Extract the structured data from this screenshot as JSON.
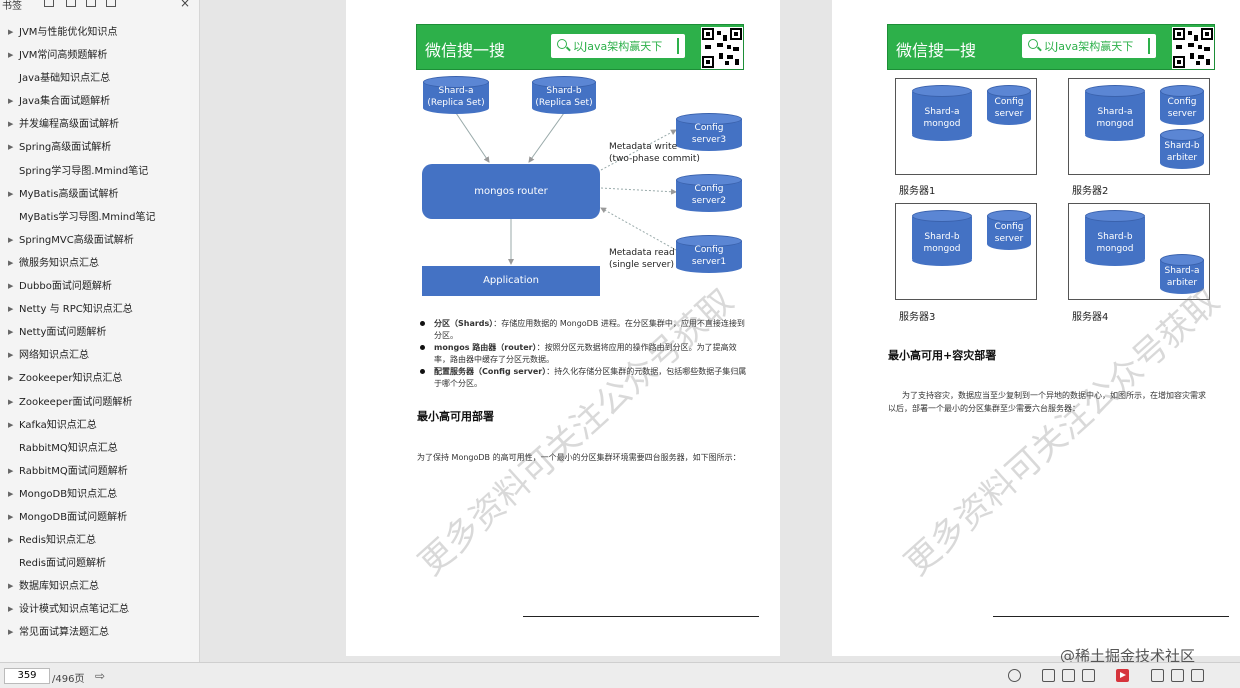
{
  "sidebar": {
    "title": "书签",
    "items": [
      {
        "label": "JVM与性能优化知识点",
        "arrow": true
      },
      {
        "label": "JVM常问高频题解析",
        "arrow": true
      },
      {
        "label": "Java基础知识点汇总",
        "arrow": false
      },
      {
        "label": "Java集合面试题解析",
        "arrow": true
      },
      {
        "label": "并发编程高级面试解析",
        "arrow": true
      },
      {
        "label": "Spring高级面试解析",
        "arrow": true
      },
      {
        "label": "Spring学习导图.Mmind笔记",
        "arrow": false
      },
      {
        "label": "MyBatis高级面试解析",
        "arrow": true
      },
      {
        "label": "MyBatis学习导图.Mmind笔记",
        "arrow": false
      },
      {
        "label": "SpringMVC高级面试解析",
        "arrow": true
      },
      {
        "label": "微服务知识点汇总",
        "arrow": true
      },
      {
        "label": "Dubbo面试问题解析",
        "arrow": true
      },
      {
        "label": " Netty 与 RPC知识点汇总",
        "arrow": true
      },
      {
        "label": "Netty面试问题解析",
        "arrow": true
      },
      {
        "label": "网络知识点汇总",
        "arrow": true
      },
      {
        "label": "Zookeeper知识点汇总",
        "arrow": true
      },
      {
        "label": "Zookeeper面试问题解析",
        "arrow": true
      },
      {
        "label": "Kafka知识点汇总",
        "arrow": true
      },
      {
        "label": "RabbitMQ知识点汇总",
        "arrow": false
      },
      {
        "label": "RabbitMQ面试问题解析",
        "arrow": true
      },
      {
        "label": "MongoDB知识点汇总",
        "arrow": true
      },
      {
        "label": "MongoDB面试问题解析",
        "arrow": true
      },
      {
        "label": "Redis知识点汇总",
        "arrow": true
      },
      {
        "label": "Redis面试问题解析",
        "arrow": false
      },
      {
        "label": "数据库知识点汇总",
        "arrow": true
      },
      {
        "label": "设计模式知识点笔记汇总",
        "arrow": true
      },
      {
        "label": "常见面试算法题汇总",
        "arrow": true
      }
    ]
  },
  "banner": {
    "brand": "微信搜一搜",
    "search_text": "以Java架构赢天下"
  },
  "left_page": {
    "shard_a": [
      "Shard-a",
      "(Replica Set)"
    ],
    "shard_b": [
      "Shard-b",
      "(Replica Set)"
    ],
    "config3": [
      "Config",
      "server3"
    ],
    "config2": [
      "Config",
      "server2"
    ],
    "config1": [
      "Config",
      "server1"
    ],
    "router": "mongos router",
    "application": "Application",
    "meta_write": [
      "Metadata write",
      "(two-phase commit)"
    ],
    "meta_read": [
      "Metadata read",
      "(single server)"
    ],
    "bullets": [
      {
        "bold": "分区（Shards）",
        "text": "：存储应用数据的 MongoDB 进程。在分区集群中，应用不直接连接到分区。"
      },
      {
        "bold": "mongos 路由器（router）",
        "text": "：按照分区元数据将应用的操作路由到分区。为了提高效率，路由器中缓存了分区元数据。"
      },
      {
        "bold": "配置服务器（Config server）",
        "text": "：持久化存储分区集群的元数据，包括哪些数据子集归属于哪个分区。"
      }
    ],
    "heading": "最小高可用部署",
    "paragraph": "为了保持 MongoDB 的高可用性，一个最小的分区集群环境需要四台服务器，如下图所示："
  },
  "right_page": {
    "servers": [
      {
        "label": "服务器1",
        "shard": [
          "Shard-a",
          "mongod"
        ],
        "config": [
          "Config",
          "server"
        ],
        "extra": null
      },
      {
        "label": "服务器2",
        "shard": [
          "Shard-a",
          "mongod"
        ],
        "config": [
          "Config",
          "server"
        ],
        "extra": [
          "Shard-b",
          "arbiter"
        ]
      },
      {
        "label": "服务器3",
        "shard": [
          "Shard-b",
          "mongod"
        ],
        "config": [
          "Config",
          "server"
        ],
        "extra": null
      },
      {
        "label": "服务器4",
        "shard": [
          "Shard-b",
          "mongod"
        ],
        "config": null,
        "extra": [
          "Shard-a",
          "arbiter"
        ]
      }
    ],
    "heading": "最小高可用+容灾部署",
    "paragraph_1": "为了支持容灾，数据应当至少复制到一个异地的数据中心，如图所示，在增加容灾需求",
    "paragraph_2": "以后，部署一个最小的分区集群至少需要六台服务器："
  },
  "watermark": "更多资料可关注公众号获取",
  "bottom": {
    "page_current": "359",
    "page_total": "/496页",
    "site": "@稀土掘金技术社区"
  }
}
